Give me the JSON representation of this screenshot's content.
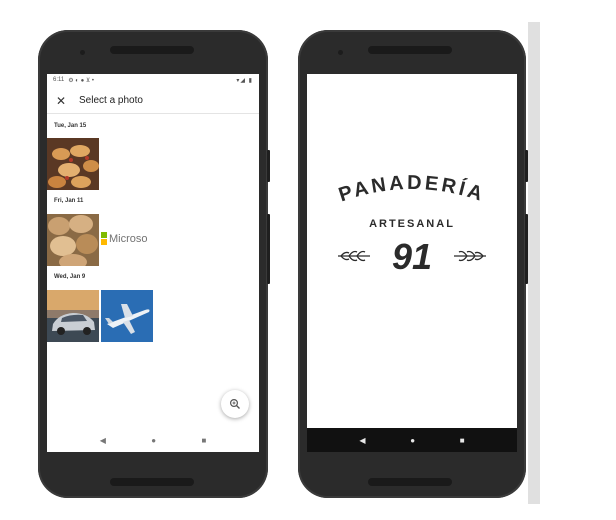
{
  "left_phone": {
    "status": {
      "time": "6:11",
      "icons": "⚙ ◐ ● ⊻ •",
      "right": "▾◢ ▮"
    },
    "app_bar": {
      "close_icon": "close-icon",
      "title": "Select a photo"
    },
    "groups": [
      {
        "date": "Tue, Jan 15",
        "photos": [
          "pastries"
        ]
      },
      {
        "date": "Fri, Jan 11",
        "photos": [
          "bread-loaves",
          "microsoft-logo"
        ]
      },
      {
        "date": "Wed, Jan 9",
        "photos": [
          "car",
          "airplane"
        ]
      }
    ],
    "microsoft_text": "Microso",
    "fab_icon": "zoom-in-icon",
    "nav": {
      "back": "◀",
      "home": "●",
      "recents": "■"
    }
  },
  "right_phone": {
    "logo": {
      "title": "PANADERÍA",
      "subtitle": "ARTESANAL",
      "number": "91"
    },
    "nav": {
      "back": "◀",
      "home": "●",
      "recents": "■"
    }
  },
  "colors": {
    "phone_body": "#2b2b2b",
    "screen_bg": "#ffffff",
    "logo_ink": "#2b2b2b",
    "dark_nav": "#111111"
  }
}
